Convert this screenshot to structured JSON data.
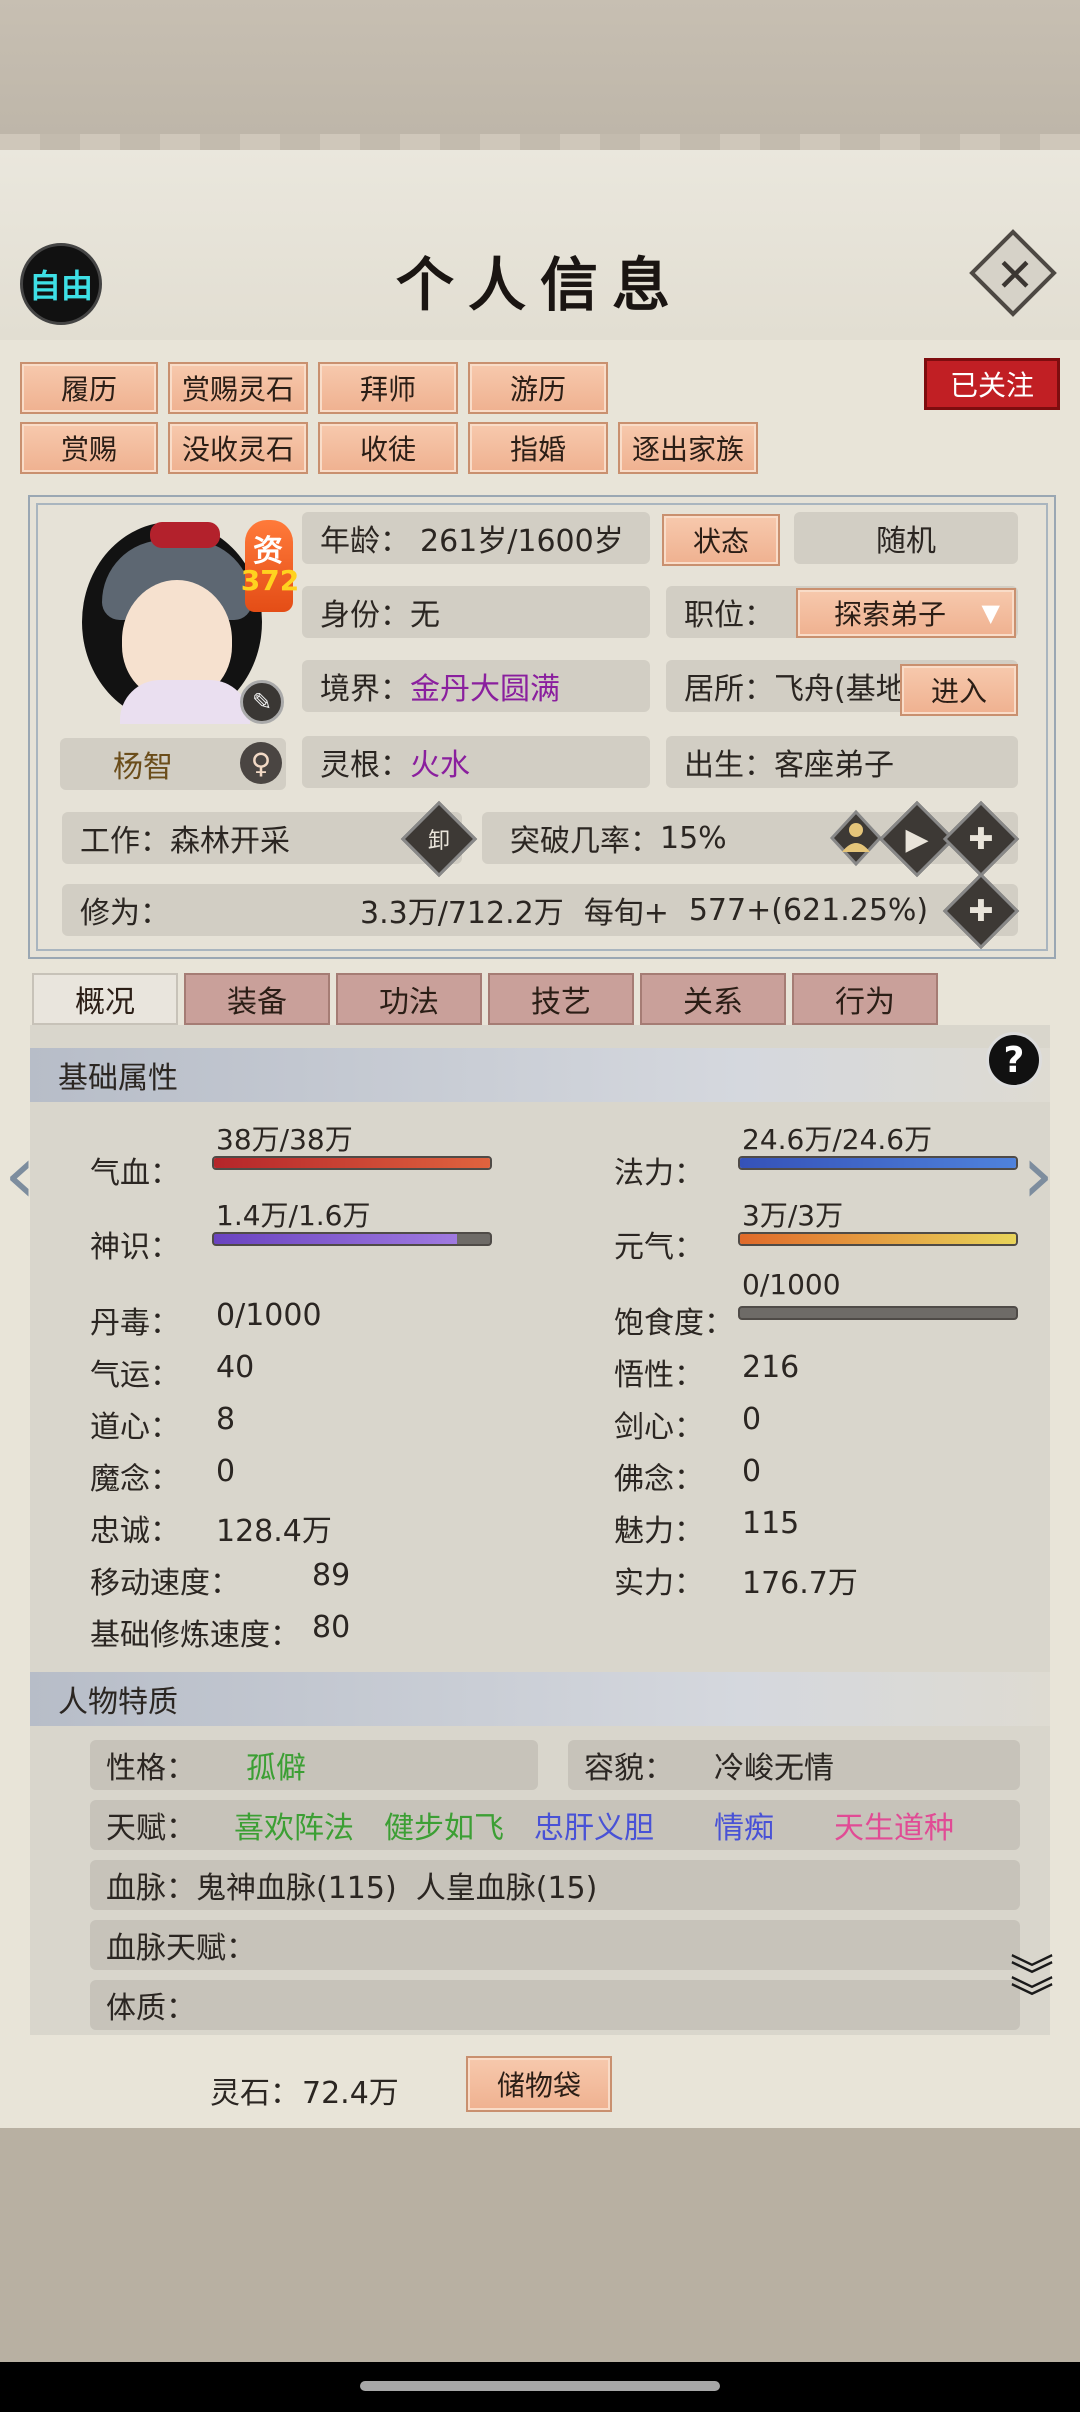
{
  "header": {
    "free_label": "自由",
    "title": "个人信息",
    "close_glyph": "✕"
  },
  "actions_row1": [
    "履历",
    "赏赐灵石",
    "拜师",
    "游历"
  ],
  "actions_row2": [
    "赏赐",
    "没收灵石",
    "收徒",
    "指婚",
    "逐出家族"
  ],
  "follow_label": "已关注",
  "avatar": {
    "zi": "资",
    "zi_value": "372"
  },
  "name": "杨智",
  "info": {
    "age_label": "年龄：",
    "age_value": "261岁/1600岁",
    "status_btn": "状态",
    "random_btn": "随机",
    "identity_label": "身份：",
    "identity_value": "无",
    "position_label": "职位：",
    "position_value": "探索弟子",
    "realm_label": "境界：",
    "realm_value": "金丹大圆满",
    "residence_label": "居所：",
    "residence_value": "飞舟(基地",
    "enter_btn": "进入",
    "root_label": "灵根：",
    "root_value": "火水",
    "birth_label": "出生：",
    "birth_value": "客座弟子",
    "work_label": "工作：",
    "work_value": "森林开采",
    "unload_glyph": "卸",
    "break_label": "突破几率：",
    "break_value": "15%",
    "cultivation_label": "修为：",
    "cultivation_value": "3.3万/712.2万",
    "per_turn_label": "每旬+",
    "per_turn_value": "577+(621.25%)"
  },
  "tabs": [
    "概况",
    "装备",
    "功法",
    "技艺",
    "关系",
    "行为"
  ],
  "basic": {
    "title": "基础属性",
    "help": "?",
    "qixue_label": "气血：",
    "qixue_value": "38万/38万",
    "qixue_pct": 1.0,
    "fali_label": "法力：",
    "fali_value": "24.6万/24.6万",
    "fali_pct": 1.0,
    "shenshi_label": "神识：",
    "shenshi_value": "1.4万/1.6万",
    "shenshi_pct": 0.88,
    "yuanqi_label": "元气：",
    "yuanqi_value": "3万/3万",
    "yuanqi_pct": 1.0,
    "baoshi_label": "饱食度：",
    "baoshi_value": "0/1000",
    "baoshi_pct": 0,
    "stats_left": [
      {
        "label": "丹毒：",
        "value": "0/1000"
      },
      {
        "label": "气运：",
        "value": "40"
      },
      {
        "label": "道心：",
        "value": "8"
      },
      {
        "label": "魔念：",
        "value": "0"
      },
      {
        "label": "忠诚：",
        "value": "128.4万"
      },
      {
        "label": "移动速度：",
        "value": "89"
      },
      {
        "label": "基础修炼速度：",
        "value": "80"
      }
    ],
    "stats_right": [
      {
        "label": "悟性：",
        "value": "216"
      },
      {
        "label": "剑心：",
        "value": "0"
      },
      {
        "label": "佛念：",
        "value": "0"
      },
      {
        "label": "魅力：",
        "value": "115"
      },
      {
        "label": "实力：",
        "value": "176.7万"
      }
    ]
  },
  "traits": {
    "title": "人物特质",
    "personality_label": "性格：",
    "personality_value": "孤僻",
    "looks_label": "容貌：",
    "looks_value": "冷峻无情",
    "talent_label": "天赋：",
    "talents": [
      "喜欢阵法",
      "健步如飞",
      "忠肝义胆",
      "情痴",
      "天生道种"
    ],
    "blood_label": "血脉：",
    "blood_value": "鬼神血脉(115)  人皇血脉(15)",
    "blood_talent_label": "血脉天赋：",
    "physique_label": "体质："
  },
  "footer": {
    "spirit_stone_label": "灵石：",
    "spirit_stone_value": "72.4万",
    "bag_btn": "储物袋"
  },
  "colors": {
    "qixue": "#c8332f",
    "fali": "#3d63c8",
    "shenshi": "#7d55c9",
    "yuanqi": "#e0852b",
    "realm": "#8a1f9e"
  }
}
